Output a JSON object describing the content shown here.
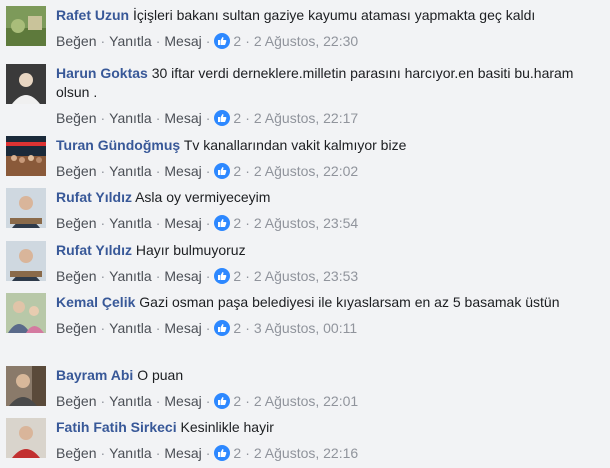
{
  "actions": {
    "like": "Beğen",
    "reply": "Yanıtla",
    "message": "Mesaj"
  },
  "comments": [
    {
      "author": "Rafet Uzun",
      "text": "İçişleri bakanı sultan gaziye kayumu ataması yapmakta geç kaldı",
      "likes": "2",
      "time": "2 Ağustos, 22:30",
      "avatar": "landscape"
    },
    {
      "author": "Harun Goktas",
      "text": "30 iftar verdi derneklere.milletin parasını harcıyor.en basiti bu.haram olsun .",
      "likes": "2",
      "time": "2 Ağustos, 22:17",
      "avatar": "person-dark"
    },
    {
      "author": "Turan Gündoğmuş",
      "text": "Tv kanallarından vakit kalmıyor bize",
      "likes": "2",
      "time": "2 Ağustos, 22:02",
      "avatar": "crowd"
    },
    {
      "author": "Rufat Yıldız",
      "text": "Asla oy vermiyeceyim",
      "likes": "2",
      "time": "2 Ağustos, 23:54",
      "avatar": "person-desk"
    },
    {
      "author": "Rufat Yıldız",
      "text": "Hayır bulmuyoruz",
      "likes": "2",
      "time": "2 Ağustos, 23:53",
      "avatar": "person-desk"
    },
    {
      "author": "Kemal Çelik",
      "text": "Gazi osman paşa belediyesi ile kıyaslarsam en az 5 basamak üstün",
      "likes": "2",
      "time": "3 Ağustos, 00:11",
      "avatar": "family"
    },
    {
      "author": "Bayram Abi",
      "text": "O puan",
      "likes": "2",
      "time": "2 Ağustos, 22:01",
      "avatar": "person-street"
    },
    {
      "author": "Fatih Fatih Sirkeci",
      "text": "Kesinlikle hayir",
      "likes": "2",
      "time": "2 Ağustos, 22:16",
      "avatar": "person-red"
    }
  ],
  "colors": {
    "link": "#385898",
    "meta": "#90949c",
    "like_badge": "#2d88ff",
    "background": "#f2f3f5"
  }
}
